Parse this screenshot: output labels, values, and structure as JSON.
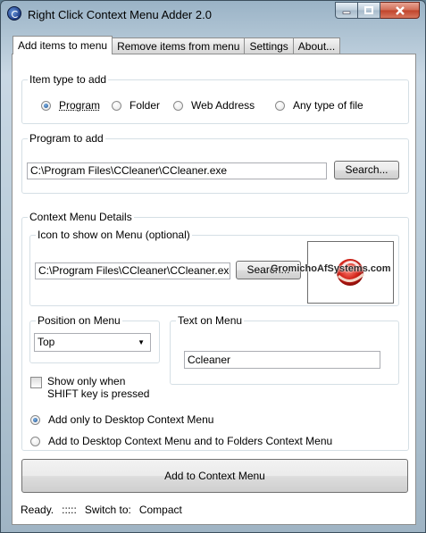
{
  "window": {
    "title": "Right Click Context Menu Adder 2.0",
    "icon": "app-logo-icon",
    "controls": {
      "minimize": "minimize-icon",
      "maximize": "maximize-icon",
      "close": "close-icon"
    }
  },
  "tabs": [
    {
      "label": "Add items to menu",
      "active": true
    },
    {
      "label": "Remove items from menu",
      "active": false
    },
    {
      "label": "Settings",
      "active": false
    },
    {
      "label": "About...",
      "active": false
    }
  ],
  "item_type": {
    "title": "Item type to add",
    "options": [
      {
        "label": "Program",
        "checked": true
      },
      {
        "label": "Folder",
        "checked": false
      },
      {
        "label": "Web Address",
        "checked": false
      },
      {
        "label": "Any type of file",
        "checked": false
      }
    ]
  },
  "program": {
    "title": "Program to add",
    "path": "C:\\Program Files\\CCleaner\\CCleaner.exe",
    "search_label": "Search..."
  },
  "details": {
    "title": "Context Menu Details",
    "icon_group": {
      "title": "Icon to show on Menu (optional)",
      "path": "C:\\Program Files\\CCleaner\\CCleaner.exe",
      "search_label": "Search...",
      "preview_icon": "ccleaner-icon"
    },
    "position": {
      "title": "Position on Menu",
      "selected": "Top"
    },
    "text": {
      "title": "Text on Menu",
      "value": "Ccleaner"
    },
    "shift_checkbox": {
      "label": "Show only when SHIFT key is pressed",
      "checked": false
    },
    "context_options": [
      {
        "label": "Add only to Desktop Context Menu",
        "checked": true
      },
      {
        "label": "Add to Desktop Context Menu and to Folders Context Menu",
        "checked": false
      }
    ]
  },
  "add_button": "Add to Context Menu",
  "status": {
    "state": "Ready.",
    "grip": ":::::",
    "switch_label": "Switch to:",
    "mode": "Compact"
  },
  "watermark": "GromichoAfSystems.com"
}
